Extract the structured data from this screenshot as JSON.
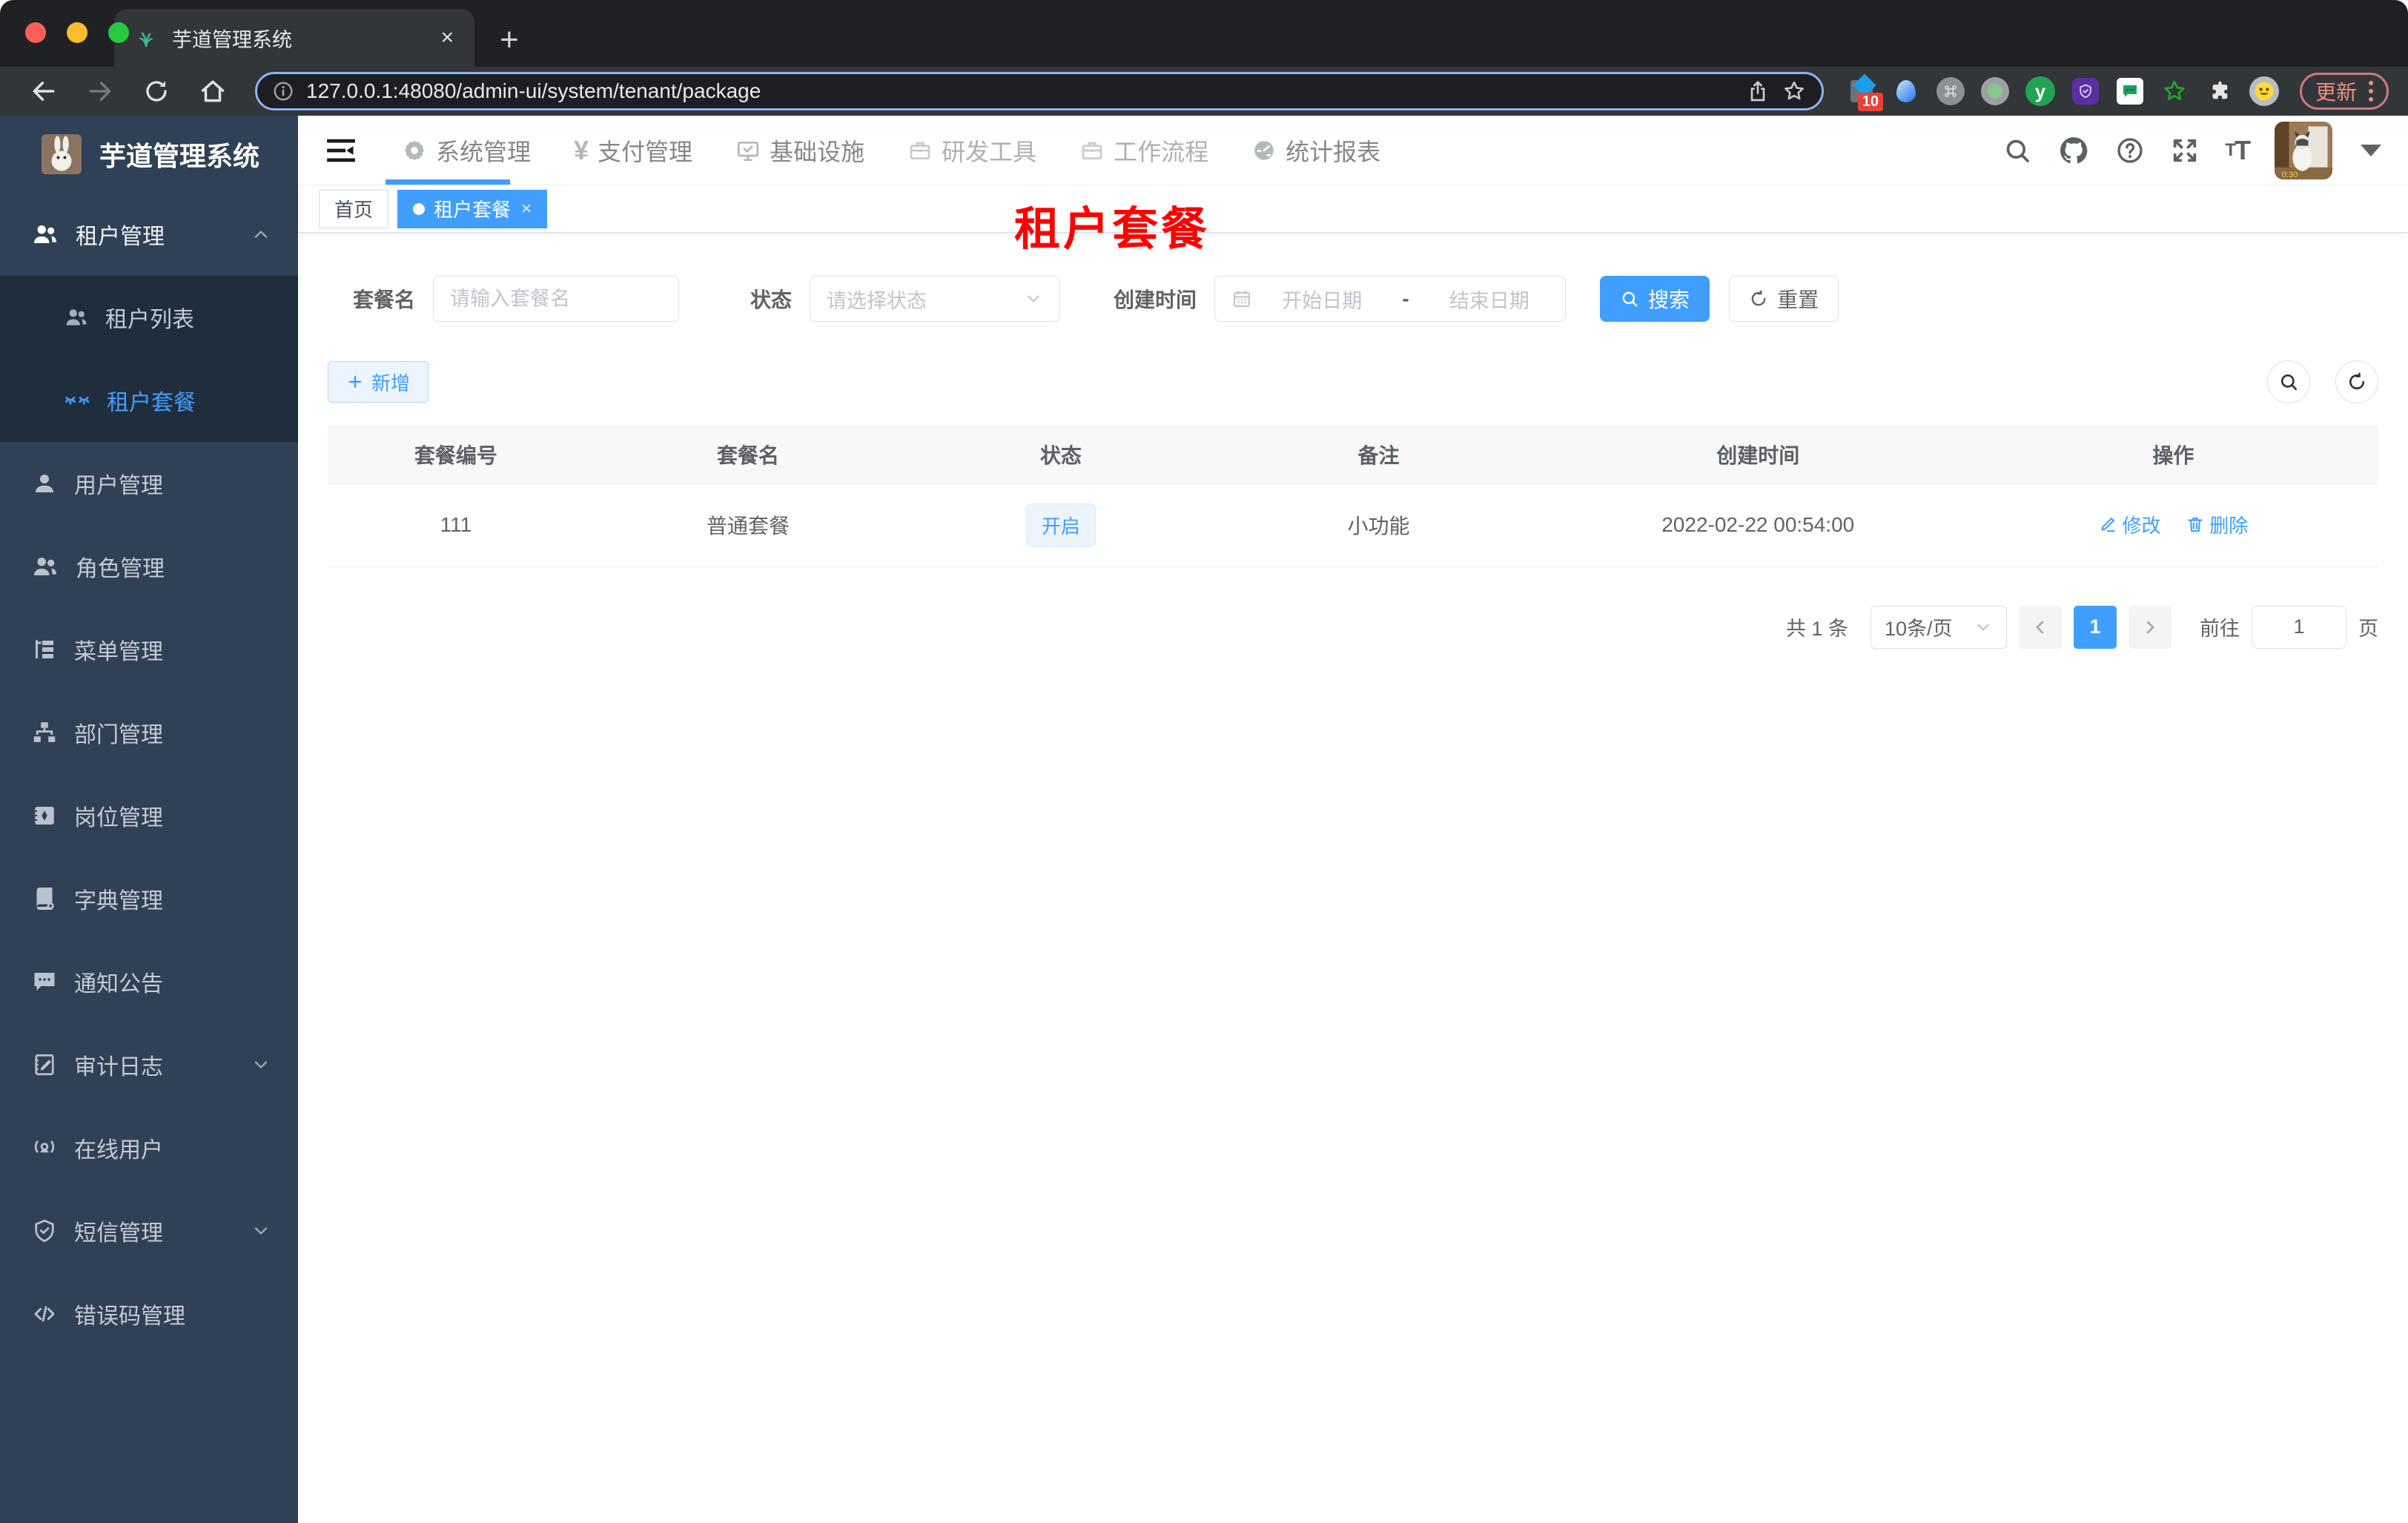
{
  "browser": {
    "tab": {
      "title": "芋道管理系统",
      "close": "×",
      "new_tab": "+"
    },
    "url": "127.0.0.1:48080/admin-ui/system/tenant/package",
    "extensions_badge": "10",
    "update_label": "更新"
  },
  "header": {
    "nav": [
      {
        "label": "系统管理",
        "icon": "gear-icon"
      },
      {
        "label": "支付管理",
        "icon": "yen-icon"
      },
      {
        "label": "基础设施",
        "icon": "monitor-icon"
      },
      {
        "label": "研发工具",
        "icon": "briefcase-icon"
      },
      {
        "label": "工作流程",
        "icon": "briefcase-icon"
      },
      {
        "label": "统计报表",
        "icon": "dashboard-icon"
      }
    ]
  },
  "sidebar": {
    "title": "芋道管理系统",
    "tenant_group": "租户管理",
    "tenant_list": "租户列表",
    "tenant_package": "租户套餐",
    "items": [
      {
        "label": "用户管理",
        "icon": "user-icon"
      },
      {
        "label": "角色管理",
        "icon": "users-icon"
      },
      {
        "label": "菜单管理",
        "icon": "menu-tree-icon"
      },
      {
        "label": "部门管理",
        "icon": "org-chart-icon"
      },
      {
        "label": "岗位管理",
        "icon": "id-badge-icon"
      },
      {
        "label": "字典管理",
        "icon": "dictionary-icon"
      },
      {
        "label": "通知公告",
        "icon": "announcement-icon"
      },
      {
        "label": "审计日志",
        "icon": "audit-log-icon"
      },
      {
        "label": "在线用户",
        "icon": "online-user-icon"
      },
      {
        "label": "短信管理",
        "icon": "sms-shield-icon"
      },
      {
        "label": "错误码管理",
        "icon": "error-code-icon"
      }
    ]
  },
  "tags": {
    "home": "首页",
    "active": "租户套餐"
  },
  "page": {
    "overlay_title": "租户套餐",
    "filters": {
      "name_label": "套餐名",
      "name_placeholder": "请输入套餐名",
      "status_label": "状态",
      "status_placeholder": "请选择状态",
      "date_label": "创建时间",
      "date_start": "开始日期",
      "date_separator": "-",
      "date_end": "结束日期",
      "search_label": "搜索",
      "reset_label": "重置"
    },
    "toolbar": {
      "add_label": "新增"
    },
    "table": {
      "columns": [
        "套餐编号",
        "套餐名",
        "状态",
        "备注",
        "创建时间",
        "操作"
      ],
      "rows": [
        {
          "id": "111",
          "name": "普通套餐",
          "status": "开启",
          "remark": "小功能",
          "created_at": "2022-02-22 00:54:00",
          "edit_label": "修改",
          "delete_label": "删除"
        }
      ]
    },
    "pagination": {
      "total": "共 1 条",
      "page_size": "10条/页",
      "current_page": "1",
      "goto_label": "前往",
      "goto_value": "1",
      "page_unit": "页"
    }
  },
  "colors": {
    "accent": "#409eff",
    "sidebar_bg": "#304156",
    "submenu_bg": "#1f2d3d",
    "title_red": "#ff0000"
  }
}
